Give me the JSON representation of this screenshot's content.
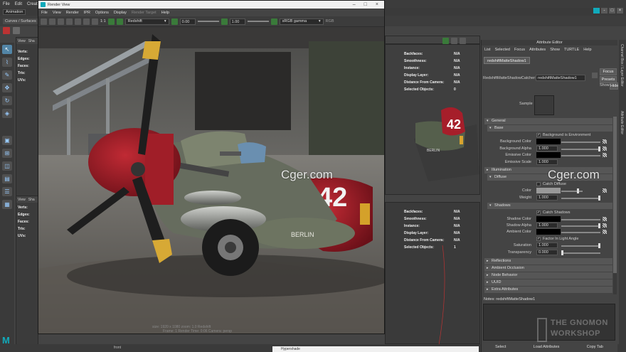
{
  "maya": {
    "menus": [
      "File",
      "Edit",
      "Create"
    ],
    "mode": "Animation",
    "shelf_tab": "Curves / Surfaces",
    "window_controls": [
      "-",
      "□",
      "×"
    ]
  },
  "viewport_left": {
    "menu": [
      "View",
      "Sha"
    ],
    "hud_labels": [
      "Verts:",
      "Edges:",
      "Faces:",
      "Tris:",
      "UVs:"
    ]
  },
  "viewport_left_bottom": {
    "menu": [
      "View",
      "Sha"
    ],
    "hud_labels": [
      "Verts:",
      "Edges:",
      "Faces:",
      "Tris:",
      "UVs:"
    ]
  },
  "hud_top": {
    "rows": [
      {
        "k": "Backfaces:",
        "v": "N/A"
      },
      {
        "k": "Smoothness:",
        "v": "N/A"
      },
      {
        "k": "Instance:",
        "v": "N/A"
      },
      {
        "k": "Display Layer:",
        "v": "N/A"
      },
      {
        "k": "Distance From Camera:",
        "v": "N/A"
      },
      {
        "k": "Selected Objects:",
        "v": "0"
      }
    ]
  },
  "hud_bottom": {
    "rows": [
      {
        "k": "Backfaces:",
        "v": "N/A"
      },
      {
        "k": "Smoothness:",
        "v": "N/A"
      },
      {
        "k": "Instance:",
        "v": "N/A"
      },
      {
        "k": "Display Layer:",
        "v": "N/A"
      },
      {
        "k": "Distance From Camera:",
        "v": "N/A"
      },
      {
        "k": "Selected Objects:",
        "v": "1"
      }
    ]
  },
  "render_view": {
    "title": "Render View",
    "menus": [
      "File",
      "View",
      "Render",
      "IPR",
      "Options",
      "Display",
      "Render Target",
      "Help"
    ],
    "renderer": "Redshift",
    "ratio": "1:1",
    "exposure": "0.00",
    "gamma": "1.00",
    "color_space": "sRGB gamma",
    "rgb_label": "RGB",
    "footer": "size: 1920 x 1080   zoom: 1.0   Redshift",
    "footer2": "Frame: 1     Render Time: 0:06     Camera: persp"
  },
  "attribute_editor": {
    "title": "Attribute Editor",
    "menus": [
      "List",
      "Selected",
      "Focus",
      "Attributes",
      "Show",
      "TURTLE",
      "Help"
    ],
    "node_tab": "redshiftMatteShadow1",
    "node_type_label": "RedshiftMatteShadowCatcher:",
    "node_name": "redshiftMatteShadow1",
    "focus_btn": "Focus",
    "presets_btn": "Presets",
    "show_label": "Show",
    "hide_btn": "Hide",
    "sample_label": "Sample",
    "sections": {
      "general": "General",
      "base": "Base",
      "illumination": "Illumination",
      "diffuse": "Diffuse",
      "shadows": "Shadows",
      "reflections": "Reflections",
      "ambient_occlusion": "Ambient Occlusion",
      "node_behavior": "Node Behavior",
      "uuid": "UUID",
      "extra": "Extra Attributes"
    },
    "base": {
      "bg_env": "Background is Environment",
      "bg_color": "Background Color",
      "bg_alpha": "Background Alpha",
      "bg_alpha_val": "1.000",
      "emissive_color": "Emissive Color",
      "emissive_scale": "Emissive Scale",
      "emissive_scale_val": "1.000"
    },
    "diffuse": {
      "catch_diffuse": "Catch Diffuse",
      "color": "Color",
      "weight": "Weight",
      "weight_val": "1.000"
    },
    "shadows": {
      "catch_shadows": "Catch Shadows",
      "shadow_color": "Shadow Color",
      "shadow_alpha": "Shadow Alpha",
      "shadow_alpha_val": "1.000",
      "ambient_color": "Ambient Color",
      "factor_light_angle": "Factor In Light Angle",
      "saturation": "Saturation",
      "saturation_val": "1.000",
      "transparency": "Transparency",
      "transparency_val": "0.000"
    },
    "notes_label": "Notes:  redshiftMatteShadow1",
    "bottom": [
      "Select",
      "Load Attributes",
      "Copy Tab"
    ]
  },
  "side_tabs": [
    "Channel Box / Layer Editor",
    "Attribute Editor"
  ],
  "watermarks": [
    "Cger.com",
    "Cger.com"
  ],
  "gnomon": {
    "line1": "THE GNOMON",
    "line2": "WORKSHOP"
  },
  "timeline": {
    "front": "front"
  },
  "hypershade_title": "Hypershade",
  "plane_number": "42",
  "plane_name": "BERLIN"
}
